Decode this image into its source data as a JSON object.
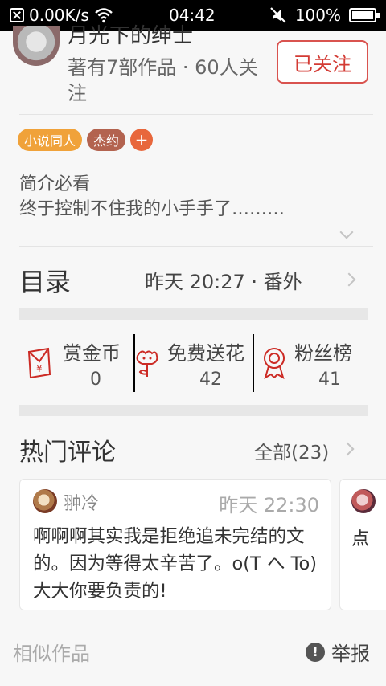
{
  "status_bar": {
    "net_speed": "0.00K/s",
    "time": "04:42",
    "battery": "100%"
  },
  "author": {
    "name": "月光下的绅士",
    "stats": "著有7部作品 · 60人关注",
    "follow_label": "已关注"
  },
  "tags": [
    {
      "label": "小说同人",
      "color": "#f0a23a"
    },
    {
      "label": "杰约",
      "color": "#b3634f"
    }
  ],
  "tag_add": "+",
  "intro": {
    "title": "简介必看",
    "text": "终于控制不住我的小手手了………"
  },
  "catalog": {
    "title": "目录",
    "info": "昨天 20:27 · 番外"
  },
  "stats": {
    "reward": {
      "label": "赏金币",
      "value": "0"
    },
    "flowers": {
      "label": "免费送花",
      "value": "42"
    },
    "fans": {
      "label": "粉丝榜",
      "value": "41"
    }
  },
  "hot_comments": {
    "title": "热门评论",
    "all_label": "全部(23)",
    "items": [
      {
        "user": "翀冷",
        "time": "昨天 22:30",
        "text": "啊啊啊其实我是拒绝追未完结的文的。因为等得太辛苦了。o(T へ To)大大你要负责的!"
      },
      {
        "text": "点"
      }
    ]
  },
  "footer": {
    "similar_label": "相似作品",
    "report_label": "举报"
  },
  "colors": {
    "accent_red": "#d33b34",
    "icon_red": "#cc2b25"
  }
}
